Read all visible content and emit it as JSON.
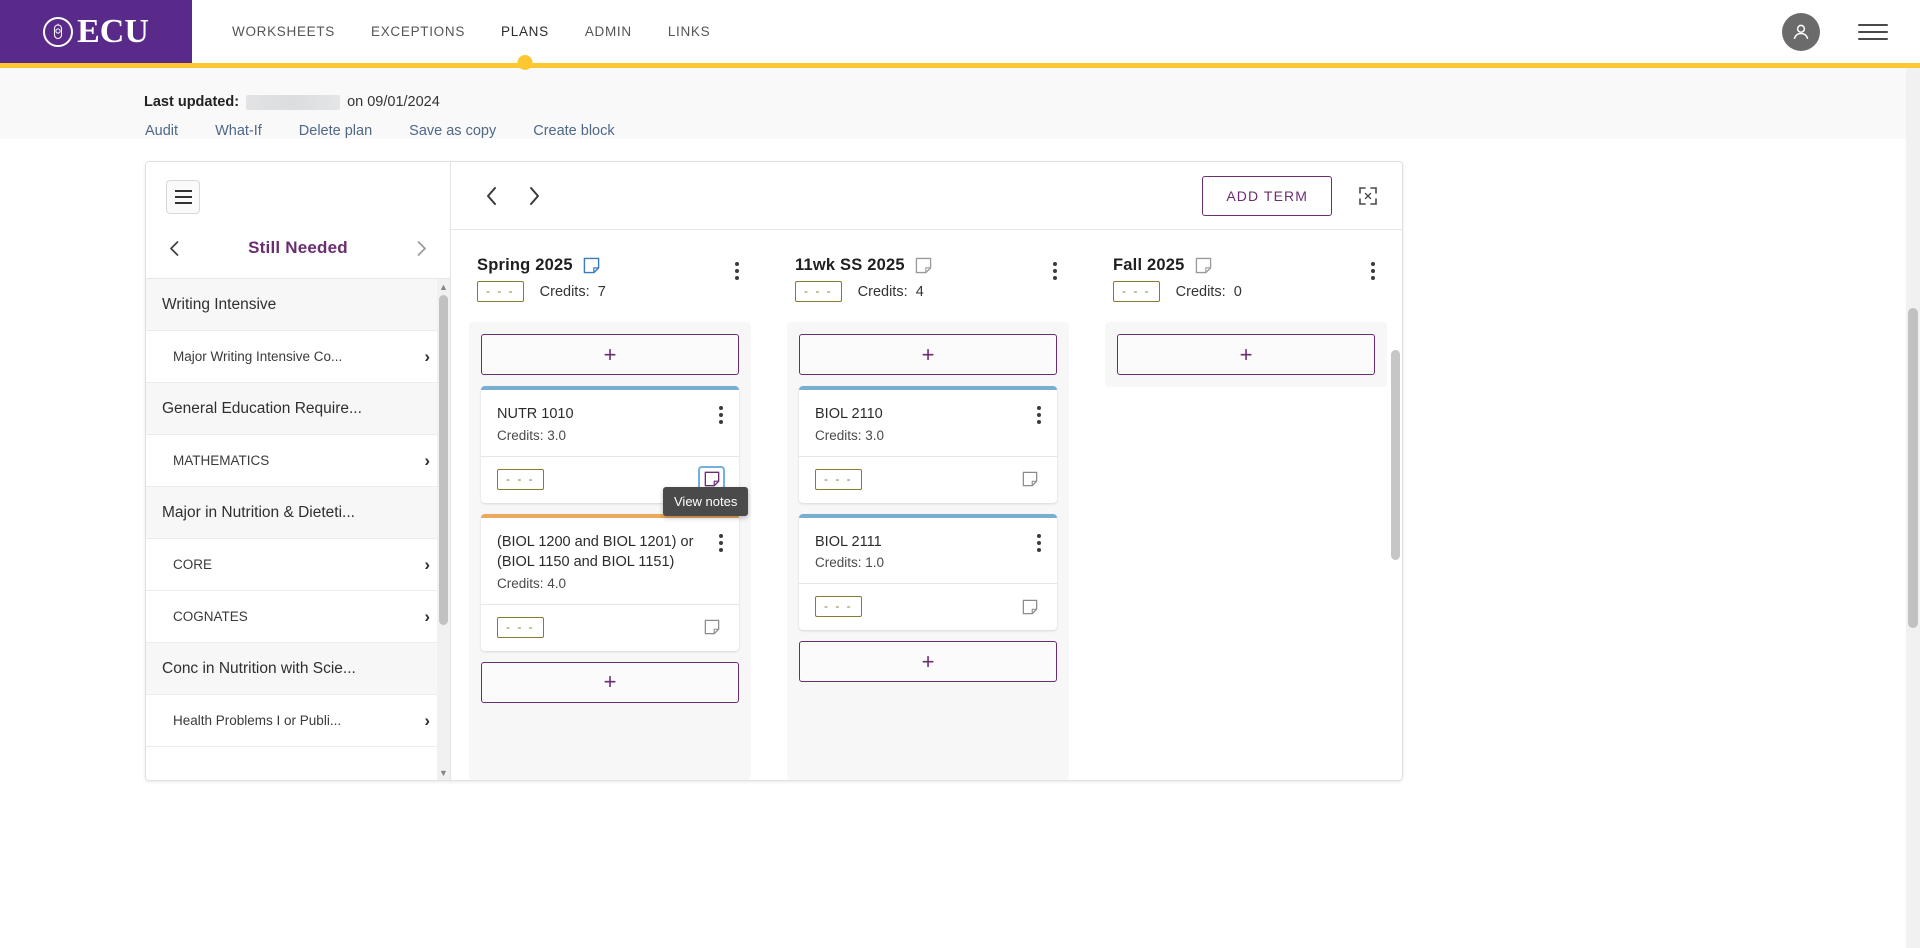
{
  "brand": {
    "name": "ECU",
    "purple": "#592a8a",
    "gold": "#fdc82f",
    "accent": "#6b2d71"
  },
  "nav": {
    "items": [
      {
        "label": "WORKSHEETS",
        "active": false
      },
      {
        "label": "EXCEPTIONS",
        "active": false
      },
      {
        "label": "PLANS",
        "active": true
      },
      {
        "label": "ADMIN",
        "active": false
      },
      {
        "label": "LINKS",
        "active": false
      }
    ],
    "avatar_icon": "user-avatar-icon",
    "menu_icon": "hamburger-menu-icon"
  },
  "meta": {
    "last_updated_label": "Last updated:",
    "redacted_value": "",
    "on_text": "on 09/01/2024"
  },
  "actions": [
    {
      "label": "Audit"
    },
    {
      "label": "What-If"
    },
    {
      "label": "Delete plan"
    },
    {
      "label": "Save as copy"
    },
    {
      "label": "Create block"
    }
  ],
  "sidebar": {
    "title": "Still Needed",
    "prev_icon": "chevron-left-icon",
    "next_icon": "chevron-right-icon",
    "menu_icon": "hamburger-icon",
    "items": [
      {
        "label": "Writing Intensive",
        "type": "group",
        "arrow": false
      },
      {
        "label": "Major Writing Intensive Co...",
        "type": "child",
        "arrow": true
      },
      {
        "label": "General Education Require...",
        "type": "group",
        "arrow": false
      },
      {
        "label": "MATHEMATICS",
        "type": "child",
        "arrow": true
      },
      {
        "label": "Major in Nutrition & Dieteti...",
        "type": "group",
        "arrow": false
      },
      {
        "label": "CORE",
        "type": "child",
        "arrow": true
      },
      {
        "label": "COGNATES",
        "type": "child",
        "arrow": true
      },
      {
        "label": "Conc in Nutrition with Scie...",
        "type": "group",
        "arrow": false
      },
      {
        "label": "Health Problems I or Publi...",
        "type": "child",
        "arrow": true
      }
    ]
  },
  "toolbar": {
    "prev_icon": "chevron-left-icon",
    "next_icon": "chevron-right-icon",
    "add_term_label": "ADD TERM",
    "expand_icon": "expand-fullscreen-icon"
  },
  "tooltip": {
    "text": "View notes"
  },
  "terms": [
    {
      "title": "Spring 2025",
      "placeholder": "- - -",
      "credits_label": "Credits:",
      "credits": "7",
      "note_icon": "sticky-note-icon",
      "note_active": true,
      "menu_icon": "kebab-menu-icon",
      "add_label": "+",
      "add_top": true,
      "add_bottom": true,
      "courses": [
        {
          "title": "NUTR 1010",
          "credits": "Credits: 3.0",
          "placeholder": "- - -",
          "accent": "blue",
          "note_icon": "sticky-note-icon",
          "note_focused": true
        },
        {
          "title": "(BIOL 1200 and BIOL 1201) or (BIOL 1150 and BIOL 1151)",
          "credits": "Credits: 4.0",
          "placeholder": "- - -",
          "accent": "orange",
          "note_icon": "sticky-note-icon",
          "note_focused": false
        }
      ]
    },
    {
      "title": "11wk SS 2025",
      "placeholder": "- - -",
      "credits_label": "Credits:",
      "credits": "4",
      "note_icon": "sticky-note-icon",
      "note_active": false,
      "menu_icon": "kebab-menu-icon",
      "add_label": "+",
      "add_top": true,
      "add_bottom": true,
      "courses": [
        {
          "title": "BIOL 2110",
          "credits": "Credits: 3.0",
          "placeholder": "- - -",
          "accent": "blue",
          "note_icon": "sticky-note-icon",
          "note_focused": false
        },
        {
          "title": "BIOL 2111",
          "credits": "Credits: 1.0",
          "placeholder": "- - -",
          "accent": "blue",
          "note_icon": "sticky-note-icon",
          "note_focused": false
        }
      ]
    },
    {
      "title": "Fall 2025",
      "placeholder": "- - -",
      "credits_label": "Credits:",
      "credits": "0",
      "note_icon": "sticky-note-icon",
      "note_active": false,
      "menu_icon": "kebab-menu-icon",
      "add_label": "+",
      "add_top": true,
      "add_bottom": false,
      "courses": []
    }
  ]
}
